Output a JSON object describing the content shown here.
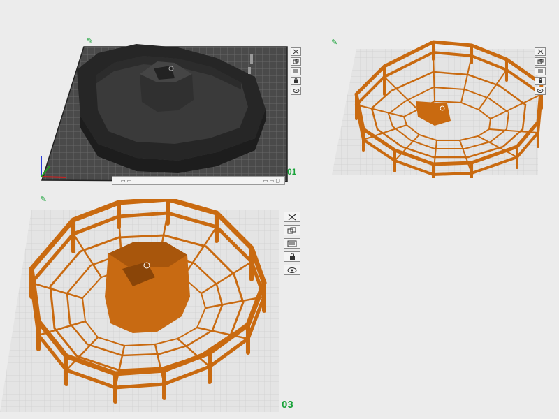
{
  "colors": {
    "background": "#ececec",
    "plate_active": "#4a4a4a",
    "plate_inactive": "#e2e2e2",
    "model_dark": "#2b2b2b",
    "model_orange": "#c96a10",
    "plate_number": "#1aa33a"
  },
  "plates": [
    {
      "number": "01",
      "state": "selected",
      "model": "octagon-bowl-dark"
    },
    {
      "number": "",
      "state": "unselected",
      "model": "octagon-lattice-orange"
    },
    {
      "number": "03",
      "state": "unselected",
      "model": "octagon-lattice-orange-with-core"
    }
  ],
  "plate_tools": [
    "close-icon",
    "auto-arrange-icon",
    "plate-settings-icon",
    "lock-icon",
    "eye-icon"
  ]
}
